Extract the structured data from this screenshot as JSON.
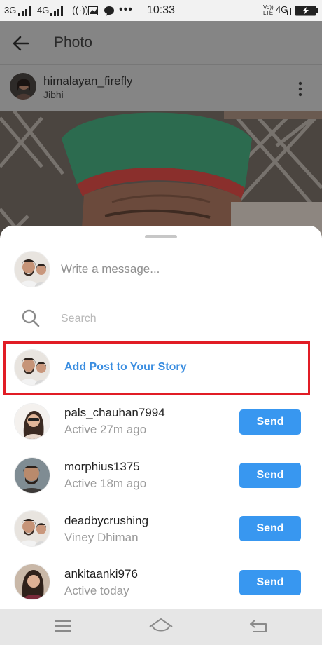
{
  "status_bar": {
    "net1": "3G",
    "net2": "4G",
    "time": "10:33",
    "volte": "Vo)) LTE",
    "net3": "4G"
  },
  "header": {
    "title": "Photo"
  },
  "post": {
    "username": "himalayan_firefly",
    "location": "Jibhi"
  },
  "share_sheet": {
    "message_placeholder": "Write a message...",
    "search_placeholder": "Search",
    "story_label": "Add Post to Your Story",
    "send_label": "Send",
    "contacts": [
      {
        "name": "pals_chauhan7994",
        "status": "Active 27m ago"
      },
      {
        "name": "morphius1375",
        "status": "Active 18m ago"
      },
      {
        "name": "deadbycrushing",
        "status": "Viney Dhiman"
      },
      {
        "name": "ankitaanki976",
        "status": "Active today"
      }
    ]
  },
  "colors": {
    "accent": "#3897f0",
    "highlight_box": "#e11c25",
    "link": "#3a8de0"
  }
}
